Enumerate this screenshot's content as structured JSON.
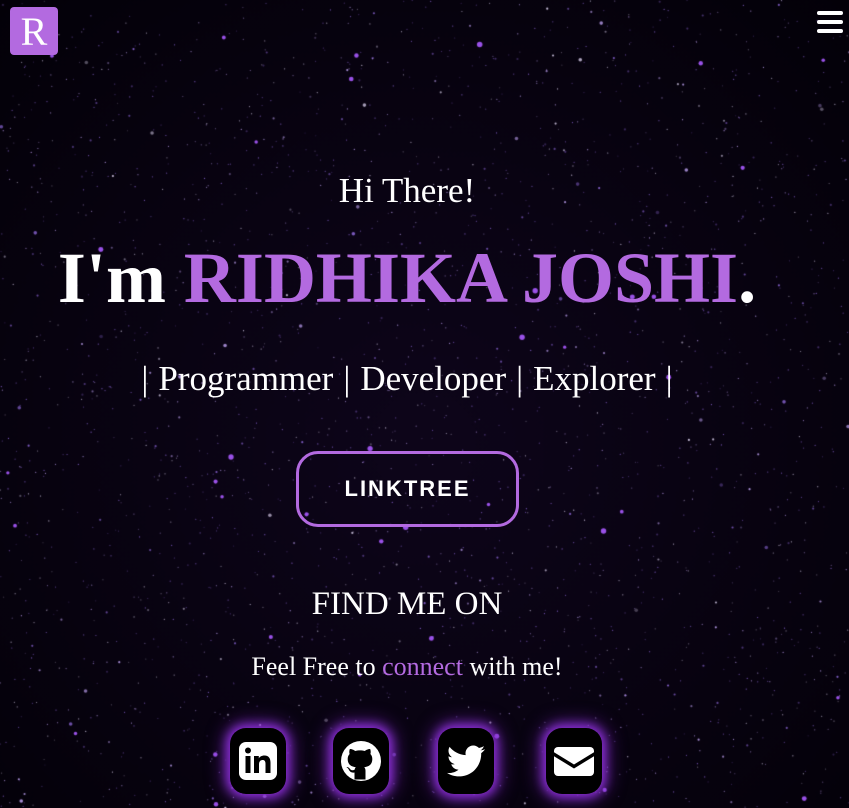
{
  "logo": {
    "letter": "R",
    "color": "#b36ae0"
  },
  "menu": {
    "icon": "hamburger-menu-icon"
  },
  "hero": {
    "greeting": "Hi There!",
    "intro_prefix": "I'm ",
    "name": "RIDHIKA JOSHI",
    "intro_suffix": ".",
    "roles": [
      "Programmer",
      "Developer",
      "Explorer"
    ],
    "separator": "|"
  },
  "linktree": {
    "label": "LINKTREE"
  },
  "find": {
    "title": "FIND ME ON",
    "text_before": "Feel Free to ",
    "text_accent": "connect",
    "text_after": " with me!"
  },
  "social": [
    {
      "name": "linkedin",
      "icon": "linkedin-icon"
    },
    {
      "name": "github",
      "icon": "github-icon"
    },
    {
      "name": "twitter",
      "icon": "twitter-icon"
    },
    {
      "name": "email",
      "icon": "envelope-icon"
    }
  ],
  "colors": {
    "accent": "#b36ae0",
    "background": "#030108",
    "glow": "#8b2fd6",
    "text": "#ffffff"
  }
}
